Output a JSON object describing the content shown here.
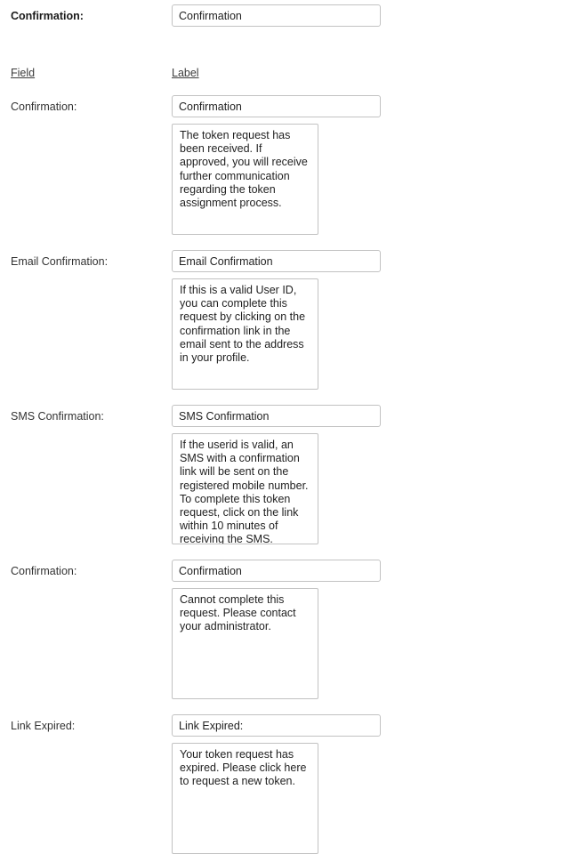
{
  "top_row": {
    "label": "Confirmation:",
    "input_value": "Confirmation"
  },
  "header": {
    "field_label": "Field",
    "label_label": "Label"
  },
  "rows": [
    {
      "label": "Confirmation:",
      "input_value": "Confirmation",
      "textarea_value": "The token request has been received. If approved, you will receive further communication regarding the token assignment process."
    },
    {
      "label": "Email Confirmation:",
      "input_value": "Email Confirmation",
      "textarea_value": "If this is a valid User ID, you can complete this request by clicking on the confirmation link in the email sent to the address in your profile."
    },
    {
      "label": "SMS Confirmation:",
      "input_value": "SMS Confirmation",
      "textarea_value": "If the userid is valid, an SMS with a confirmation link will be sent on the registered mobile number. To complete this token request, click on the link within 10 minutes of receiving the SMS."
    },
    {
      "label": "Confirmation:",
      "input_value": "Confirmation",
      "textarea_value": "Cannot complete this request. Please contact your administrator."
    },
    {
      "label": "Link Expired:",
      "input_value": "Link Expired:",
      "textarea_value": "Your token request has expired. Please click here to request a new token."
    }
  ],
  "colors": {
    "border": "#c2c2c2",
    "text": "#333333",
    "background": "#ffffff"
  }
}
